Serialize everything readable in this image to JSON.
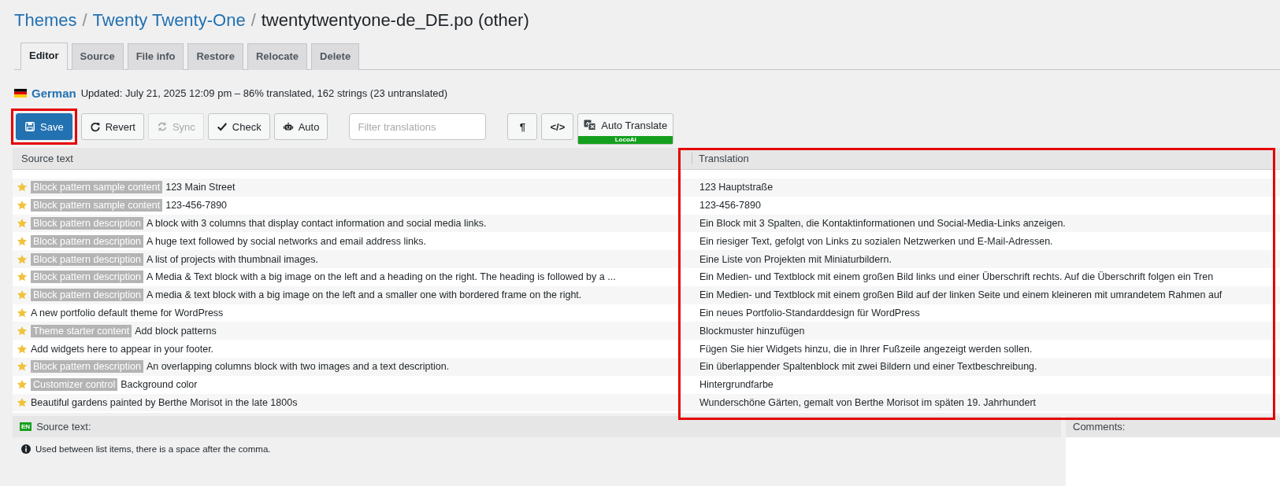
{
  "breadcrumb": [
    {
      "text": "Themes",
      "link": true,
      "separator": "/"
    },
    {
      "text": "Twenty Twenty-One",
      "link": true,
      "separator": "/"
    },
    {
      "text": "twentytwentyone-de_DE.po (other)",
      "link": false
    }
  ],
  "tabs": [
    {
      "label": "Editor",
      "selected": true
    },
    {
      "label": "Source",
      "selected": false
    },
    {
      "label": "File info",
      "selected": false
    },
    {
      "label": "Restore",
      "selected": false
    },
    {
      "label": "Relocate",
      "selected": false
    },
    {
      "label": "Delete",
      "selected": false
    }
  ],
  "language": {
    "name": "German",
    "status": "Updated: July 21, 2025 12:09 pm – 86% translated, 162 strings (23 untranslated)"
  },
  "toolbar": {
    "buttons": [
      {
        "label": "Save",
        "kind": "primary",
        "disabled": false,
        "highlighted": true
      },
      {
        "label": "Revert",
        "kind": "default",
        "disabled": false,
        "highlighted": false
      },
      {
        "label": "Sync",
        "kind": "default",
        "disabled": true,
        "highlighted": false
      },
      {
        "label": "Check",
        "kind": "default",
        "disabled": false,
        "highlighted": false
      },
      {
        "label": "Auto",
        "kind": "default",
        "disabled": false,
        "highlighted": false
      }
    ],
    "filter": {
      "placeholder": "Filter translations"
    },
    "toggles": [
      {
        "label": "¶"
      },
      {
        "label": "</>"
      }
    ],
    "auto_translate": {
      "label": "Auto Translate",
      "provider": "LocoAI"
    }
  },
  "table": {
    "columns": [
      "Source text",
      "Translation"
    ],
    "translation_highlighted": true,
    "rows": [
      {
        "starred": true,
        "context": "Block pattern sample content",
        "source": "123 Main Street",
        "translation": "123 Hauptstraße"
      },
      {
        "starred": true,
        "context": "Block pattern sample content",
        "source": "123-456-7890",
        "translation": "123-456-7890"
      },
      {
        "starred": true,
        "context": "Block pattern description",
        "source": "A block with 3 columns that display contact information and social media links.",
        "translation": "Ein Block mit 3 Spalten, die Kontaktinformationen und Social-Media-Links anzeigen."
      },
      {
        "starred": true,
        "context": "Block pattern description",
        "source": "A huge text followed by social networks and email address links.",
        "translation": "Ein riesiger Text, gefolgt von Links zu sozialen Netzwerken und E-Mail-Adressen."
      },
      {
        "starred": true,
        "context": "Block pattern description",
        "source": "A list of projects with thumbnail images.",
        "translation": "Eine Liste von Projekten mit Miniaturbildern."
      },
      {
        "starred": true,
        "context": "Block pattern description",
        "source": "A Media & Text block with a big image on the left and a heading on the right. The heading is followed by a ...",
        "translation": "Ein Medien- und Textblock mit einem großen Bild links und einer Überschrift rechts. Auf die Überschrift folgen ein Tren"
      },
      {
        "starred": true,
        "context": "Block pattern description",
        "source": "A media & text block with a big image on the left and a smaller one with bordered frame on the right.",
        "translation": "Ein Medien- und Textblock mit einem großen Bild auf der linken Seite und einem kleineren mit umrandetem Rahmen auf"
      },
      {
        "starred": true,
        "source": "A new portfolio default theme for WordPress",
        "translation": "Ein neues Portfolio-Standarddesign für WordPress"
      },
      {
        "starred": true,
        "context": "Theme starter content",
        "source": "Add block patterns",
        "translation": "Blockmuster hinzufügen"
      },
      {
        "starred": true,
        "source": "Add widgets here to appear in your footer.",
        "translation": "Fügen Sie hier Widgets hinzu, die in Ihrer Fußzeile angezeigt werden sollen."
      },
      {
        "starred": true,
        "context": "Block pattern description",
        "source": "An overlapping columns block with two images and a text description.",
        "translation": "Ein überlappender Spaltenblock mit zwei Bildern und einer Textbeschreibung."
      },
      {
        "starred": true,
        "context": "Customizer control",
        "source": "Background color",
        "translation": "Hintergrundfarbe"
      },
      {
        "starred": true,
        "source": "Beautiful gardens painted by Berthe Morisot in the late 1800s",
        "translation": "Wunderschöne Gärten, gemalt von Berthe Morisot im späten 19. Jahrhundert"
      }
    ]
  },
  "source_panel": {
    "badge": "EN",
    "title": "Source text:",
    "note": "Used between list items, there is a space after the comma."
  },
  "comments_panel": {
    "title": "Comments:"
  }
}
